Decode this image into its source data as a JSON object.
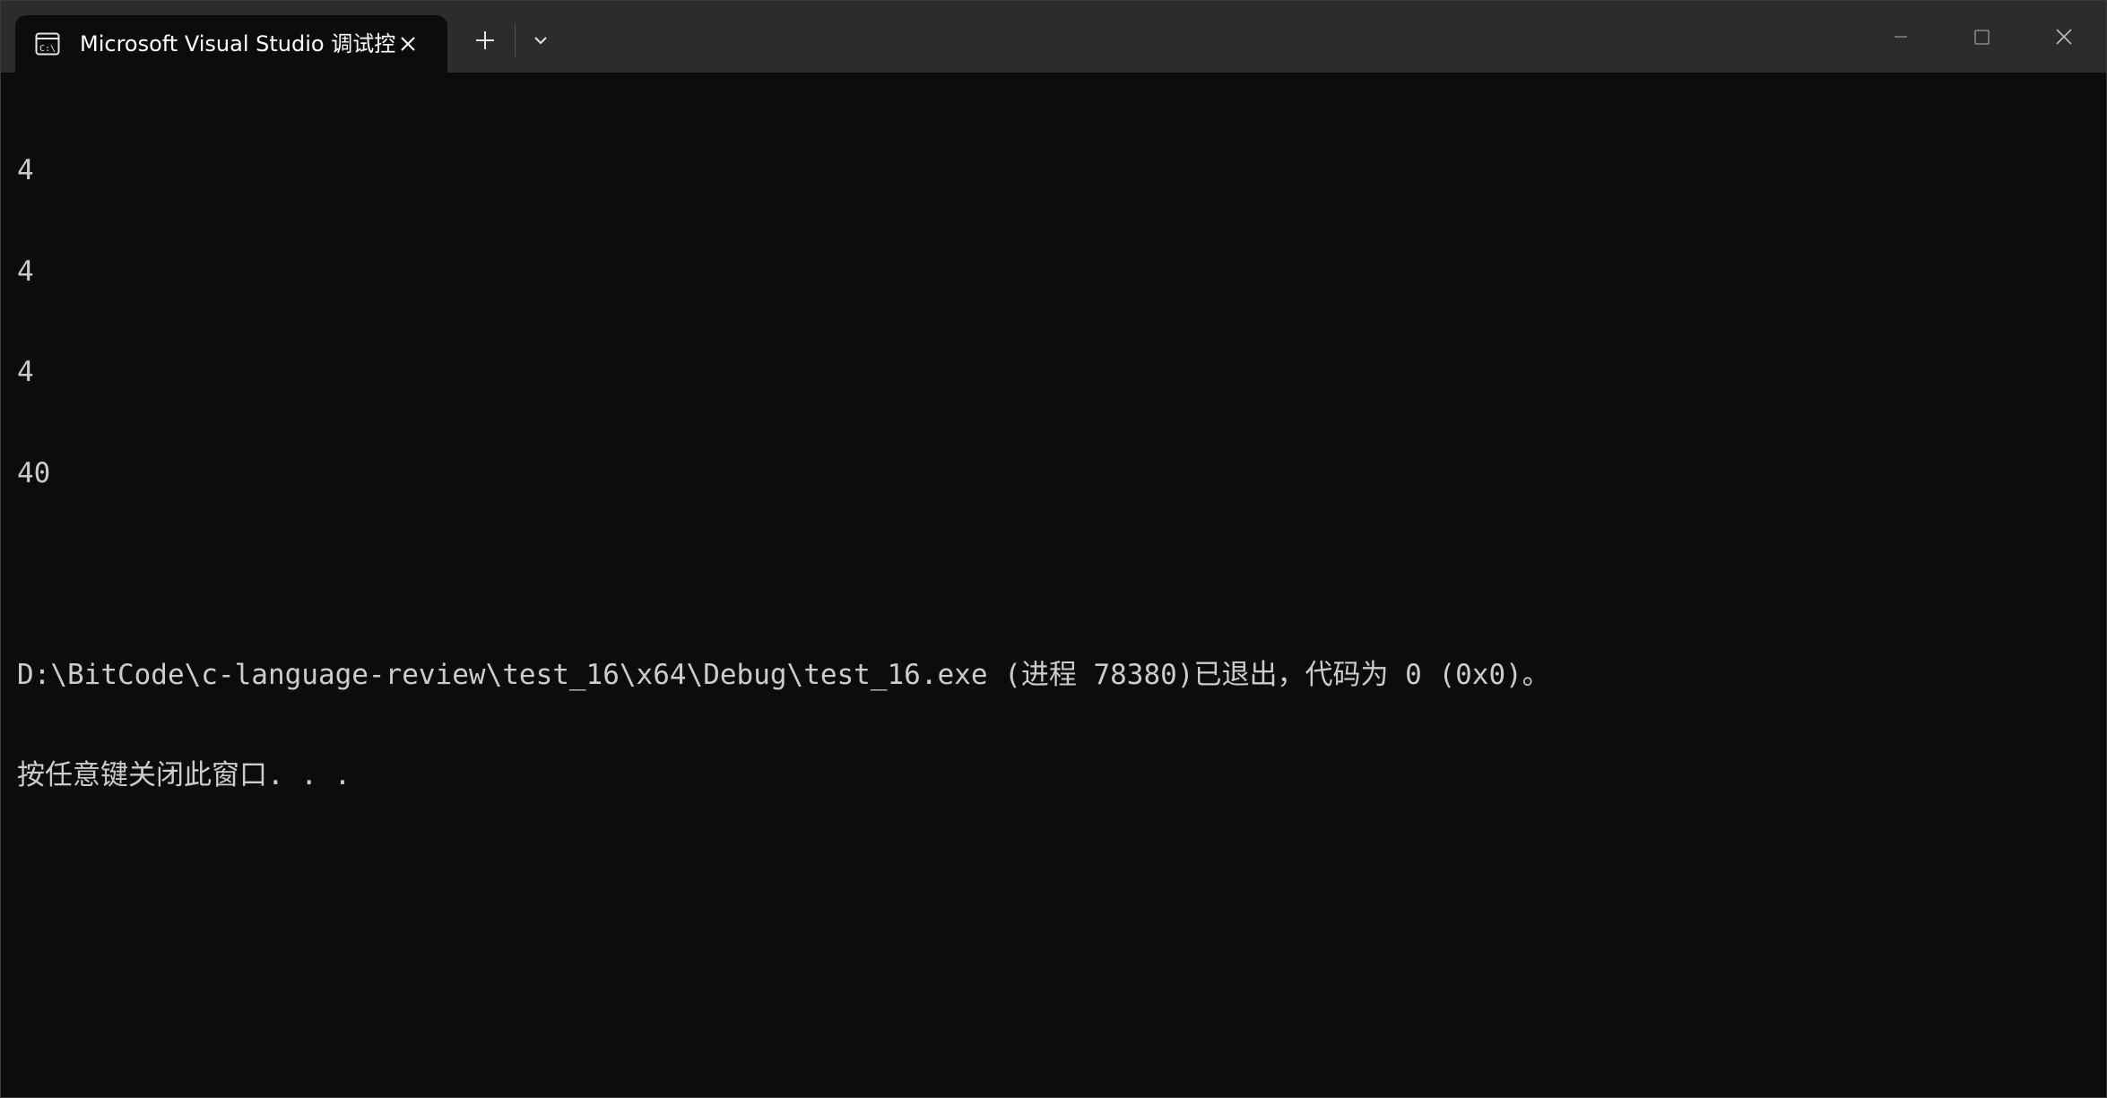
{
  "window": {
    "tab_title": "Microsoft Visual Studio 调试控",
    "tab_icon": "terminal-icon",
    "new_tab_icon": "plus-icon",
    "dropdown_icon": "chevron-down-icon",
    "minimize_icon": "minimize-icon",
    "maximize_icon": "maximize-icon",
    "close_icon": "close-icon"
  },
  "console": {
    "lines": [
      "4",
      "4",
      "4",
      "40",
      "",
      "D:\\BitCode\\c-language-review\\test_16\\x64\\Debug\\test_16.exe (进程 78380)已退出，代码为 0 (0x0)。",
      "按任意键关闭此窗口. . ."
    ]
  },
  "colors": {
    "titlebar": "#2c2c2c",
    "console_bg": "#0c0c0c",
    "text": "#cccccc",
    "tab_text": "#ffffff"
  }
}
